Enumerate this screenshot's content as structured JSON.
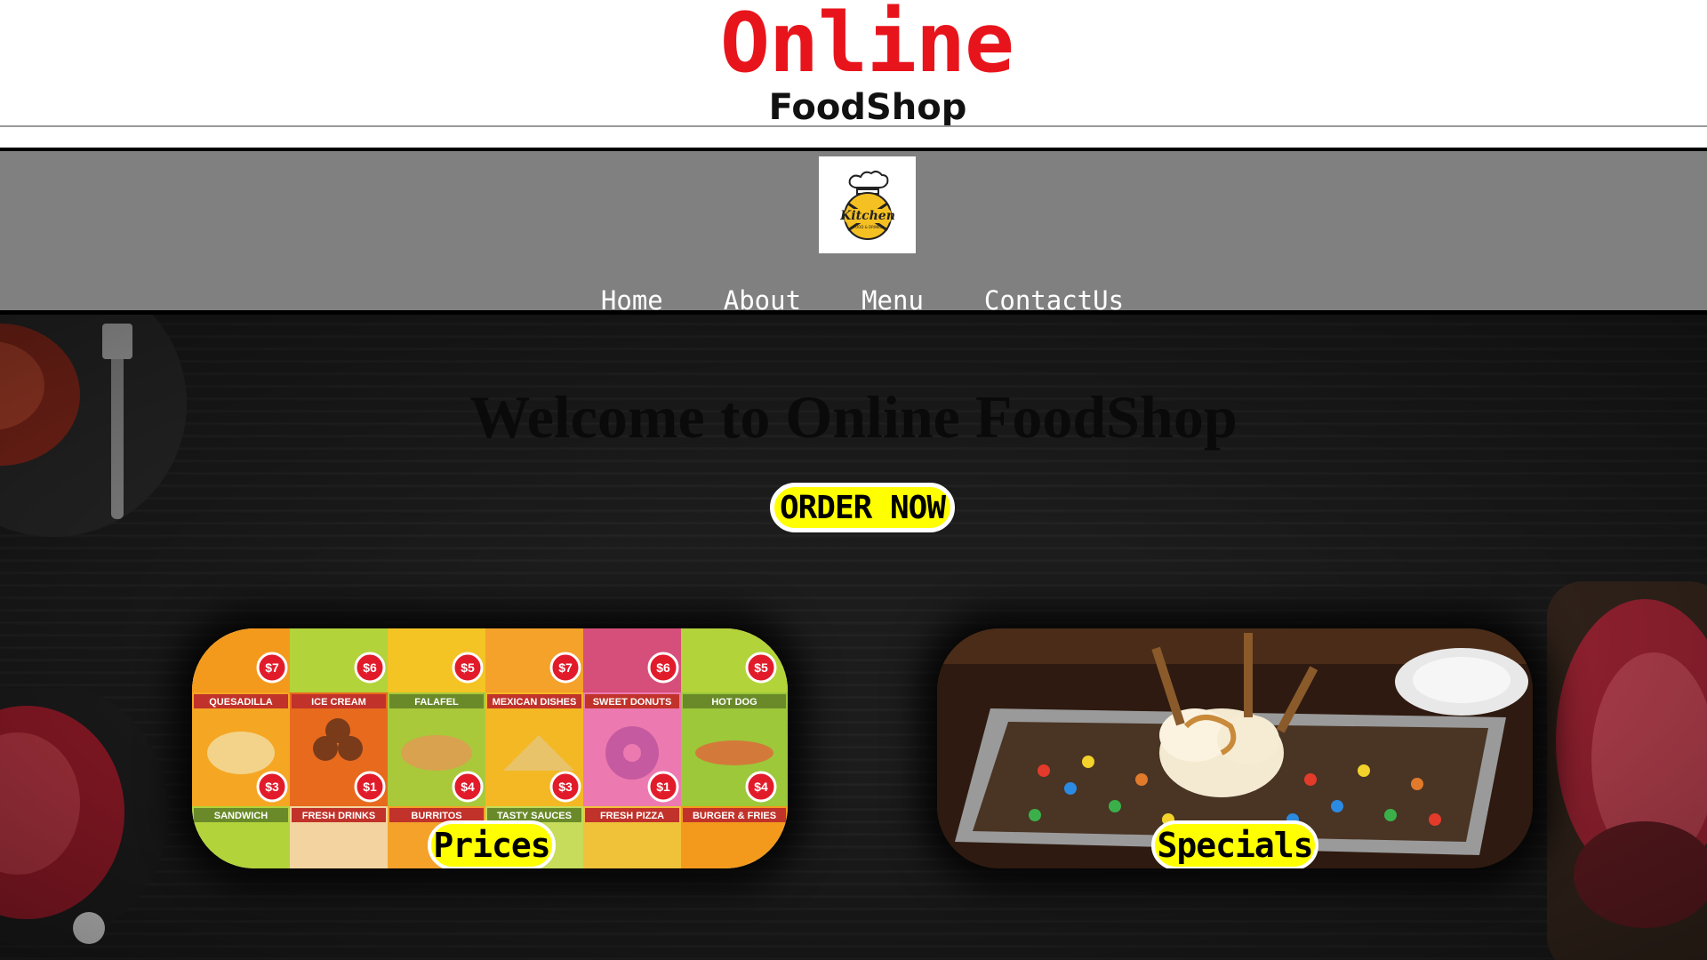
{
  "header": {
    "brand_primary": "Online",
    "brand_secondary": "FoodShop"
  },
  "nav": {
    "logo_icon": "kitchen-chef-logo-icon",
    "links": [
      "Home",
      "About",
      "Menu",
      "ContactUs"
    ]
  },
  "hero": {
    "title": "Welcome to Online FoodShop",
    "order_label": "ORDER NOW"
  },
  "cards": {
    "prices": {
      "label": "Prices",
      "tiles": [
        {
          "name": "QUESADILLA",
          "price": "$3"
        },
        {
          "name": "ICE CREAM",
          "price": "$1"
        },
        {
          "name": "FALAFEL",
          "price": "$4"
        },
        {
          "name": "MEXICAN DISHES",
          "price": "$3"
        },
        {
          "name": "SWEET DONUTS",
          "price": "$1"
        },
        {
          "name": "HOT DOG",
          "price": "$4"
        },
        {
          "name": "SANDWICH",
          "price": ""
        },
        {
          "name": "FRESH DRINKS",
          "price": ""
        },
        {
          "name": "BURRITOS",
          "price": ""
        },
        {
          "name": "TASTY SAUCES",
          "price": ""
        },
        {
          "name": "FRESH PIZZA",
          "price": ""
        },
        {
          "name": "BURGER & FRIES",
          "price": ""
        }
      ],
      "top_prices": [
        "$7",
        "$6",
        "$5",
        "$7",
        "$6",
        "$5"
      ]
    },
    "specials": {
      "label": "Specials"
    }
  },
  "colors": {
    "brand_red": "#e8141c",
    "nav_gray": "#808080",
    "button_yellow": "#ffff00"
  }
}
